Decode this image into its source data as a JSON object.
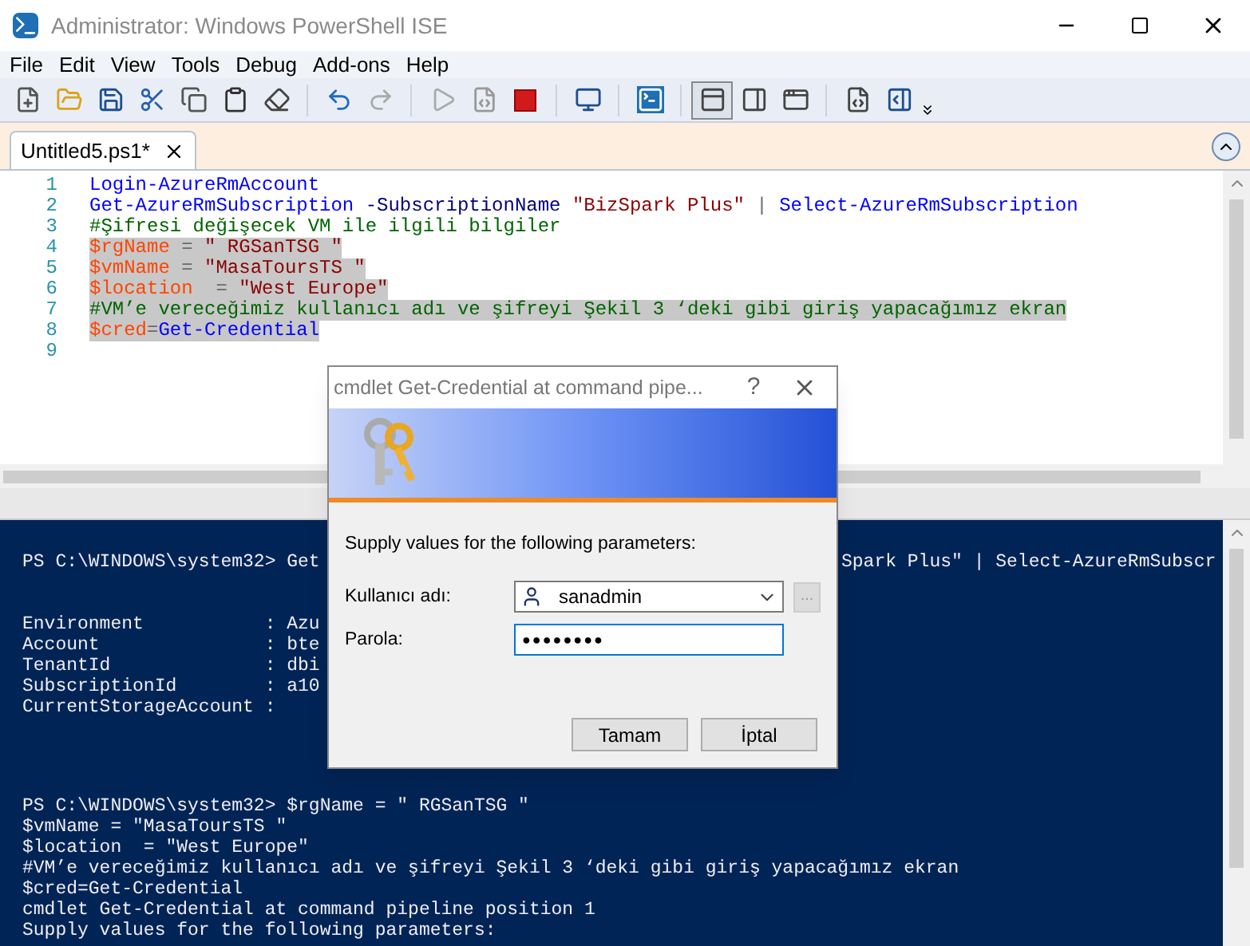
{
  "window": {
    "title": "Administrator: Windows PowerShell ISE"
  },
  "menu": [
    "File",
    "Edit",
    "View",
    "Tools",
    "Debug",
    "Add-ons",
    "Help"
  ],
  "tabs": [
    {
      "label": "Untitled5.ps1*",
      "selected": true
    }
  ],
  "editor": {
    "lines": [
      {
        "number": "1",
        "selected": false,
        "tokens": [
          {
            "kind": "cmdlet",
            "text": "Login-AzureRmAccount"
          }
        ]
      },
      {
        "number": "2",
        "selected": false,
        "tokens": [
          {
            "kind": "cmdlet",
            "text": "Get-AzureRmSubscription "
          },
          {
            "kind": "param",
            "text": "-SubscriptionName "
          },
          {
            "kind": "string",
            "text": "\"BizSpark Plus\""
          },
          {
            "kind": "operator",
            "text": " | "
          },
          {
            "kind": "cmdlet",
            "text": "Select-AzureRmSubscription"
          }
        ]
      },
      {
        "number": "3",
        "selected": false,
        "tokens": [
          {
            "kind": "comment",
            "text": "#Şifresi değişecek VM ile ilgili bilgiler"
          }
        ]
      },
      {
        "number": "4",
        "selected": true,
        "tokens": [
          {
            "kind": "variable",
            "text": "$rgName"
          },
          {
            "kind": "operator",
            "text": " = "
          },
          {
            "kind": "string",
            "text": "\" RGSanTSG \""
          }
        ]
      },
      {
        "number": "5",
        "selected": true,
        "tokens": [
          {
            "kind": "variable",
            "text": "$vmName"
          },
          {
            "kind": "operator",
            "text": " = "
          },
          {
            "kind": "string",
            "text": "\"MasaToursTS \""
          }
        ]
      },
      {
        "number": "6",
        "selected": true,
        "tokens": [
          {
            "kind": "variable",
            "text": "$location"
          },
          {
            "kind": "operator",
            "text": "  = "
          },
          {
            "kind": "string",
            "text": "\"West Europe\""
          }
        ]
      },
      {
        "number": "7",
        "selected": true,
        "tokens": [
          {
            "kind": "comment",
            "text": "#VM’e vereceğimiz kullanıcı adı ve şifreyi Şekil 3 ‘deki gibi giriş yapacağımız ekran"
          }
        ]
      },
      {
        "number": "8",
        "selected": true,
        "tokens": [
          {
            "kind": "variable",
            "text": "$cred"
          },
          {
            "kind": "operator",
            "text": "="
          },
          {
            "kind": "cmdlet",
            "text": "Get-Credential"
          }
        ]
      },
      {
        "number": "9",
        "selected": false
      }
    ]
  },
  "console": {
    "top_lines": [
      {
        "left": "PS C:\\WINDOWS\\system32> Get",
        "right": "Spark Plus\" | Select-AzureRmSubscr"
      },
      {
        "left": "Environment           : Azu"
      },
      {
        "left": "Account               : bte"
      },
      {
        "left": "TenantId              : dbi"
      },
      {
        "left": "SubscriptionId        : a10"
      },
      {
        "left": "CurrentStorageAccount :"
      }
    ],
    "bottom_lines": [
      "PS C:\\WINDOWS\\system32> $rgName = \" RGSanTSG \"",
      "$vmName = \"MasaToursTS \"",
      "$location  = \"West Europe\"",
      "#VM’e vereceğimiz kullanıcı adı ve şifreyi Şekil 3 ‘deki gibi giriş yapacağımız ekran",
      "$cred=Get-Credential",
      "cmdlet Get-Credential at command pipeline position 1",
      "Supply values for the following parameters:"
    ]
  },
  "dialog": {
    "title": "cmdlet Get-Credential at command pipe...",
    "help": "?",
    "prompt": "Supply values for the following parameters:",
    "user_label": "Kullanıcı adı:",
    "user_value": "sanadmin",
    "browse": "...",
    "password_label": "Parola:",
    "password_value": "●●●●●●●●",
    "buttons": [
      "Tamam",
      "İptal"
    ]
  }
}
